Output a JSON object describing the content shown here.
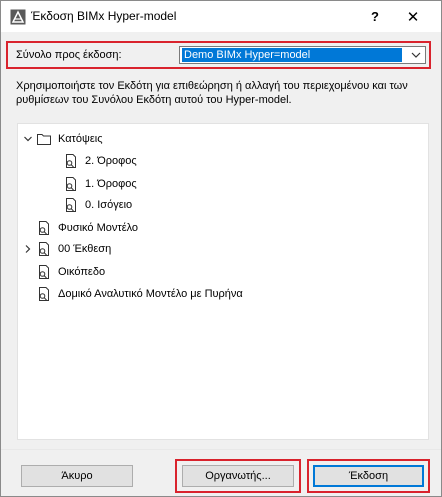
{
  "window": {
    "title": "Έκδοση BIMx Hyper-model",
    "help_label": "?",
    "close_label": "✕"
  },
  "publish_set": {
    "label": "Σύνολο προς έκδοση:",
    "selected": "Demo BIMx Hyper=model"
  },
  "description": "Χρησιμοποιήστε τον Εκδότη για επιθεώρηση ή αλλαγή του περιεχομένου και των ρυθμίσεων του Συνόλου Εκδότη αυτού του Hyper-model.",
  "tree": {
    "items": [
      {
        "label": "Κατόψεις",
        "icon": "folder-icon",
        "expander": "expanded"
      },
      {
        "label": "2. Όροφος",
        "icon": "view-document-icon",
        "expander": "none"
      },
      {
        "label": "1. Όροφος",
        "icon": "view-document-icon",
        "expander": "none"
      },
      {
        "label": "0. Ισόγειο",
        "icon": "view-document-icon",
        "expander": "none"
      },
      {
        "label": "Φυσικό Μοντέλο",
        "icon": "view-document-icon",
        "expander": "none"
      },
      {
        "label": "00 Έκθεση",
        "icon": "view-document-icon",
        "expander": "collapsed"
      },
      {
        "label": "Οικόπεδο",
        "icon": "view-document-icon",
        "expander": "none"
      },
      {
        "label": "Δομικό Αναλυτικό Μοντέλο με Πυρήνα",
        "icon": "view-document-icon",
        "expander": "none"
      }
    ]
  },
  "buttons": {
    "cancel": "Άκυρο",
    "organizer": "Οργανωτής...",
    "publish": "Έκδοση"
  },
  "colors": {
    "highlight": "#d9232d",
    "selection": "#0078d7"
  }
}
